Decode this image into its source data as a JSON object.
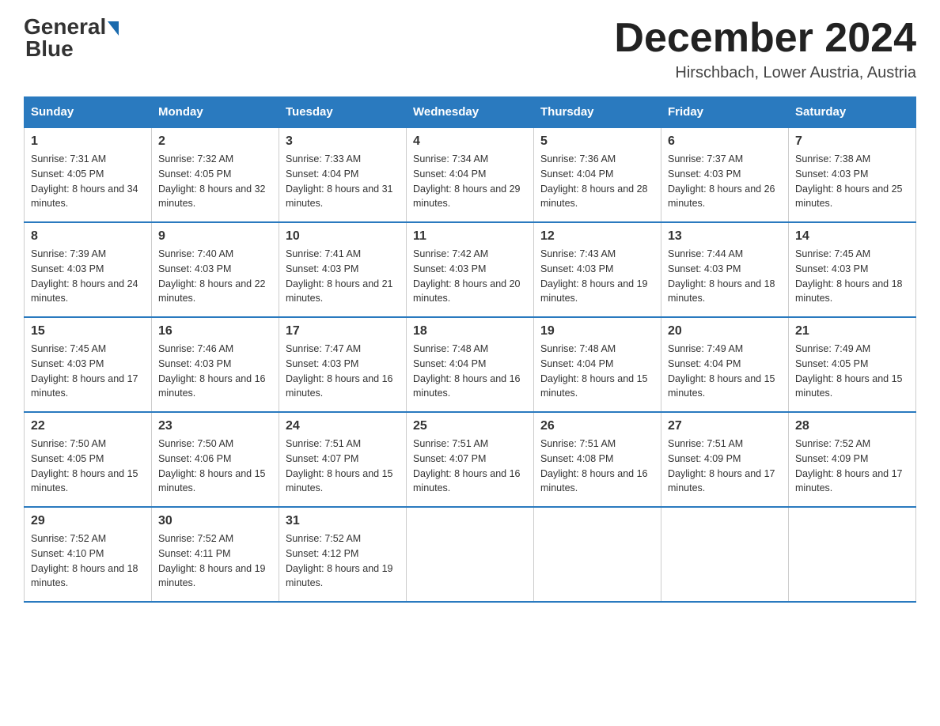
{
  "header": {
    "logo_general": "General",
    "logo_blue": "Blue",
    "month_title": "December 2024",
    "location": "Hirschbach, Lower Austria, Austria"
  },
  "weekdays": [
    "Sunday",
    "Monday",
    "Tuesday",
    "Wednesday",
    "Thursday",
    "Friday",
    "Saturday"
  ],
  "weeks": [
    [
      {
        "day": "1",
        "sunrise": "7:31 AM",
        "sunset": "4:05 PM",
        "daylight": "8 hours and 34 minutes."
      },
      {
        "day": "2",
        "sunrise": "7:32 AM",
        "sunset": "4:05 PM",
        "daylight": "8 hours and 32 minutes."
      },
      {
        "day": "3",
        "sunrise": "7:33 AM",
        "sunset": "4:04 PM",
        "daylight": "8 hours and 31 minutes."
      },
      {
        "day": "4",
        "sunrise": "7:34 AM",
        "sunset": "4:04 PM",
        "daylight": "8 hours and 29 minutes."
      },
      {
        "day": "5",
        "sunrise": "7:36 AM",
        "sunset": "4:04 PM",
        "daylight": "8 hours and 28 minutes."
      },
      {
        "day": "6",
        "sunrise": "7:37 AM",
        "sunset": "4:03 PM",
        "daylight": "8 hours and 26 minutes."
      },
      {
        "day": "7",
        "sunrise": "7:38 AM",
        "sunset": "4:03 PM",
        "daylight": "8 hours and 25 minutes."
      }
    ],
    [
      {
        "day": "8",
        "sunrise": "7:39 AM",
        "sunset": "4:03 PM",
        "daylight": "8 hours and 24 minutes."
      },
      {
        "day": "9",
        "sunrise": "7:40 AM",
        "sunset": "4:03 PM",
        "daylight": "8 hours and 22 minutes."
      },
      {
        "day": "10",
        "sunrise": "7:41 AM",
        "sunset": "4:03 PM",
        "daylight": "8 hours and 21 minutes."
      },
      {
        "day": "11",
        "sunrise": "7:42 AM",
        "sunset": "4:03 PM",
        "daylight": "8 hours and 20 minutes."
      },
      {
        "day": "12",
        "sunrise": "7:43 AM",
        "sunset": "4:03 PM",
        "daylight": "8 hours and 19 minutes."
      },
      {
        "day": "13",
        "sunrise": "7:44 AM",
        "sunset": "4:03 PM",
        "daylight": "8 hours and 18 minutes."
      },
      {
        "day": "14",
        "sunrise": "7:45 AM",
        "sunset": "4:03 PM",
        "daylight": "8 hours and 18 minutes."
      }
    ],
    [
      {
        "day": "15",
        "sunrise": "7:45 AM",
        "sunset": "4:03 PM",
        "daylight": "8 hours and 17 minutes."
      },
      {
        "day": "16",
        "sunrise": "7:46 AM",
        "sunset": "4:03 PM",
        "daylight": "8 hours and 16 minutes."
      },
      {
        "day": "17",
        "sunrise": "7:47 AM",
        "sunset": "4:03 PM",
        "daylight": "8 hours and 16 minutes."
      },
      {
        "day": "18",
        "sunrise": "7:48 AM",
        "sunset": "4:04 PM",
        "daylight": "8 hours and 16 minutes."
      },
      {
        "day": "19",
        "sunrise": "7:48 AM",
        "sunset": "4:04 PM",
        "daylight": "8 hours and 15 minutes."
      },
      {
        "day": "20",
        "sunrise": "7:49 AM",
        "sunset": "4:04 PM",
        "daylight": "8 hours and 15 minutes."
      },
      {
        "day": "21",
        "sunrise": "7:49 AM",
        "sunset": "4:05 PM",
        "daylight": "8 hours and 15 minutes."
      }
    ],
    [
      {
        "day": "22",
        "sunrise": "7:50 AM",
        "sunset": "4:05 PM",
        "daylight": "8 hours and 15 minutes."
      },
      {
        "day": "23",
        "sunrise": "7:50 AM",
        "sunset": "4:06 PM",
        "daylight": "8 hours and 15 minutes."
      },
      {
        "day": "24",
        "sunrise": "7:51 AM",
        "sunset": "4:07 PM",
        "daylight": "8 hours and 15 minutes."
      },
      {
        "day": "25",
        "sunrise": "7:51 AM",
        "sunset": "4:07 PM",
        "daylight": "8 hours and 16 minutes."
      },
      {
        "day": "26",
        "sunrise": "7:51 AM",
        "sunset": "4:08 PM",
        "daylight": "8 hours and 16 minutes."
      },
      {
        "day": "27",
        "sunrise": "7:51 AM",
        "sunset": "4:09 PM",
        "daylight": "8 hours and 17 minutes."
      },
      {
        "day": "28",
        "sunrise": "7:52 AM",
        "sunset": "4:09 PM",
        "daylight": "8 hours and 17 minutes."
      }
    ],
    [
      {
        "day": "29",
        "sunrise": "7:52 AM",
        "sunset": "4:10 PM",
        "daylight": "8 hours and 18 minutes."
      },
      {
        "day": "30",
        "sunrise": "7:52 AM",
        "sunset": "4:11 PM",
        "daylight": "8 hours and 19 minutes."
      },
      {
        "day": "31",
        "sunrise": "7:52 AM",
        "sunset": "4:12 PM",
        "daylight": "8 hours and 19 minutes."
      },
      null,
      null,
      null,
      null
    ]
  ]
}
